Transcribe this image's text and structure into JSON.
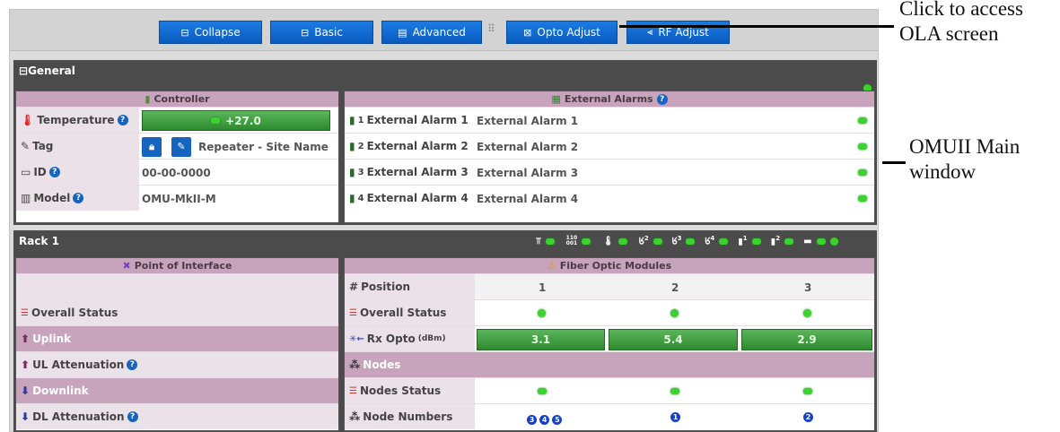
{
  "toolbar": {
    "collapse": "Collapse",
    "basic": "Basic",
    "advanced": "Advanced",
    "opto_adjust": "Opto Adjust",
    "rf_adjust": "RF Adjust"
  },
  "general": {
    "title": "General",
    "controller": {
      "header": "Controller",
      "temperature_label": "Temperature",
      "temperature_value": "+27.0",
      "tag_label": "Tag",
      "tag_value": "Repeater - Site Name",
      "id_label": "ID",
      "id_value": "00-00-0000",
      "model_label": "Model",
      "model_value": "OMU-MkII-M"
    },
    "external_alarms": {
      "header": "External Alarms",
      "items": [
        {
          "sup": "1",
          "label": "External Alarm 1",
          "value": "External Alarm 1"
        },
        {
          "sup": "2",
          "label": "External Alarm 2",
          "value": "External Alarm 2"
        },
        {
          "sup": "3",
          "label": "External Alarm 3",
          "value": "External Alarm 3"
        },
        {
          "sup": "4",
          "label": "External Alarm 4",
          "value": "External Alarm 4"
        }
      ]
    }
  },
  "rack": {
    "title": "Rack 1",
    "status_icons": [
      "ethernet-icon",
      "binary-data-icon",
      "thermometer-icon",
      "antenna-2-icon",
      "antenna-3-icon",
      "antenna-4-icon",
      "module-1-icon",
      "module-2-icon",
      "battery-icon"
    ],
    "status_numbers": {
      "binary_top": "110",
      "binary_bottom": "001",
      "ant2": "2",
      "ant3": "3",
      "ant4": "4",
      "mod1": "1",
      "mod2": "2"
    },
    "poi": {
      "header": "Point of Interface",
      "overall_status": "Overall Status",
      "uplink": "Uplink",
      "ul_attenuation": "UL Attenuation",
      "downlink": "Downlink",
      "dl_attenuation": "DL Attenuation"
    },
    "fom": {
      "header": "Fiber Optic Modules",
      "position_label": "Position",
      "positions": [
        "1",
        "2",
        "3"
      ],
      "overall_status": "Overall Status",
      "rx_opto_label": "Rx Opto",
      "rx_opto_unit": "(dBm)",
      "rx_opto_values": [
        "3.1",
        "5.4",
        "2.9"
      ],
      "nodes_label": "Nodes",
      "nodes_status": "Nodes Status",
      "node_numbers_label": "Node Numbers",
      "node_numbers": [
        [
          "3",
          "4",
          "5"
        ],
        [
          "1"
        ],
        [
          "2"
        ]
      ]
    }
  },
  "annotations": {
    "ola": "Click to access OLA screen",
    "main": "OMUII Main window"
  },
  "colors": {
    "accent_blue": "#0a5bc0",
    "status_green": "#3bd12e",
    "header_mauve": "#c7a4bb",
    "section_dark": "#4b4b4b"
  }
}
